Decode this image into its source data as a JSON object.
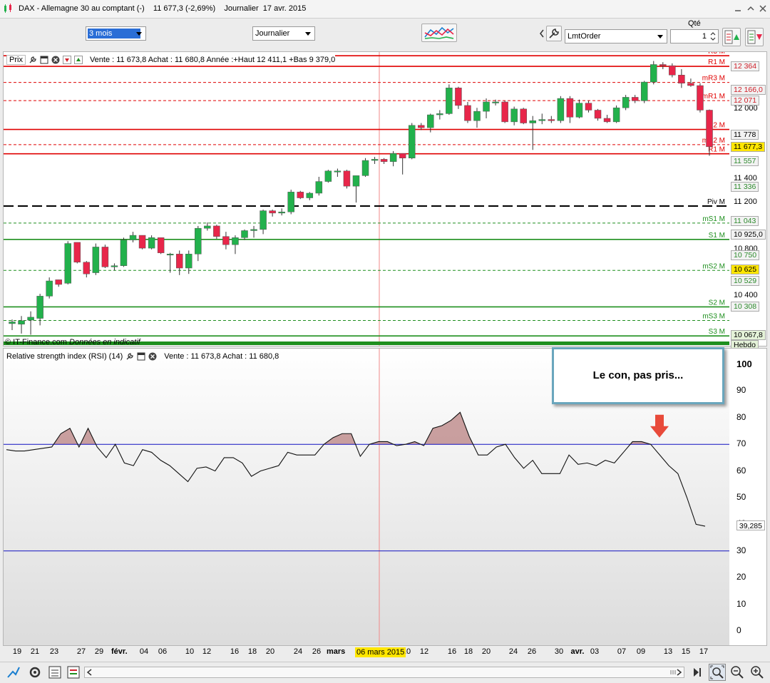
{
  "window": {
    "title": "DAX - Allemagne 30 au comptant (-)    11 677,3 (-2,69%)    Journalier  17 avr. 2015"
  },
  "toolbar": {
    "period": "3 mois",
    "interval": "Journalier",
    "order_type": "LmtOrder",
    "qty_label": "Qté",
    "qty_value": "1"
  },
  "price_panel": {
    "name": "Prix",
    "info": "Vente : 11 673,8 Achat : 11 680,8 Année :+Haut 12 411,1 +Bas 9 379,0",
    "credit_source": "© IT-Finance.com",
    "credit_note": "Données en indicatif",
    "axis_ticks": [
      "12 000",
      "11 400",
      "11 200",
      "10 800",
      "10 400"
    ],
    "price_labels": [
      {
        "text": "12 364",
        "color": "#d0202a",
        "bg": "#f2f2f2"
      },
      {
        "text": "12 166,0",
        "color": "#d0202a",
        "bg": "#f2f2f2"
      },
      {
        "text": "12 071",
        "color": "#d0202a",
        "bg": "#f2f2f2"
      },
      {
        "text": "11 778",
        "color": "#000000",
        "bg": "#f2f2f2"
      },
      {
        "text": "11 677,3",
        "color": "#000000",
        "bg": "#ffe600"
      },
      {
        "text": "11 557",
        "color": "#2e8b2e",
        "bg": "#f2f2f2"
      },
      {
        "text": "11 336",
        "color": "#2e8b2e",
        "bg": "#f2f2f2"
      },
      {
        "text": "11 043",
        "color": "#2e8b2e",
        "bg": "#f2f2f2"
      },
      {
        "text": "10 925,0",
        "color": "#000000",
        "bg": "#f2f2f2"
      },
      {
        "text": "10 750",
        "color": "#2e8b2e",
        "bg": "#f2f2f2"
      },
      {
        "text": "10 625",
        "color": "#000000",
        "bg": "#ffe600"
      },
      {
        "text": "10 529",
        "color": "#2e8b2e",
        "bg": "#f2f2f2"
      },
      {
        "text": "10 308",
        "color": "#2e8b2e",
        "bg": "#f2f2f2"
      },
      {
        "text": "10 067,8",
        "color": "#000000",
        "bg": "#e4f2d8"
      },
      {
        "text": "Hebdo",
        "color": "#000000",
        "bg": "#e4f2d8"
      }
    ]
  },
  "rsi_panel": {
    "name": "Relative strength index (RSI) (14)",
    "info": "Vente : 11 673,8 Achat : 11 680,8",
    "current_label": "39,285"
  },
  "crosshair_date": "06 mars 2015",
  "callout": {
    "text": "Le con, pas pris..."
  },
  "colors": {
    "bull": "#22b14c",
    "bear": "#e8264a",
    "resistance": "#e00000",
    "support": "#1e8f1e",
    "rsi_line": "#1010c0"
  },
  "chart_data": [
    {
      "type": "candlestick",
      "title": "DAX - Allemagne 30 au comptant (-)",
      "ylim": [
        10000,
        12450
      ],
      "x_tick_labels": [
        "19",
        "21",
        "23",
        "27",
        "29",
        "févr.",
        "04",
        "06",
        "10",
        "12",
        "16",
        "18",
        "20",
        "24",
        "26",
        "mars",
        "10",
        "12",
        "16",
        "18",
        "20",
        "24",
        "26",
        "30",
        "avr.",
        "03",
        "07",
        "09",
        "13",
        "15",
        "17"
      ],
      "candles": [
        {
          "open": 10165,
          "high": 10200,
          "low": 10110,
          "close": 10180
        },
        {
          "open": 10160,
          "high": 10230,
          "low": 10080,
          "close": 10190
        },
        {
          "open": 10195,
          "high": 10270,
          "low": 10070,
          "close": 10220
        },
        {
          "open": 10210,
          "high": 10420,
          "low": 10150,
          "close": 10400
        },
        {
          "open": 10400,
          "high": 10560,
          "low": 10380,
          "close": 10530
        },
        {
          "open": 10540,
          "high": 10540,
          "low": 10480,
          "close": 10500
        },
        {
          "open": 10510,
          "high": 10870,
          "low": 10500,
          "close": 10850
        },
        {
          "open": 10860,
          "high": 10860,
          "low": 10680,
          "close": 10690
        },
        {
          "open": 10690,
          "high": 10700,
          "low": 10560,
          "close": 10590
        },
        {
          "open": 10600,
          "high": 10850,
          "low": 10580,
          "close": 10820
        },
        {
          "open": 10820,
          "high": 10840,
          "low": 10640,
          "close": 10650
        },
        {
          "open": 10650,
          "high": 10680,
          "low": 10620,
          "close": 10660
        },
        {
          "open": 10660,
          "high": 10900,
          "low": 10650,
          "close": 10880
        },
        {
          "open": 10880,
          "high": 10950,
          "low": 10860,
          "close": 10920
        },
        {
          "open": 10920,
          "high": 10920,
          "low": 10800,
          "close": 10810
        },
        {
          "open": 10810,
          "high": 10920,
          "low": 10800,
          "close": 10900
        },
        {
          "open": 10900,
          "high": 10900,
          "low": 10760,
          "close": 10770
        },
        {
          "open": 10760,
          "high": 10770,
          "low": 10600,
          "close": 10760
        },
        {
          "open": 10760,
          "high": 10790,
          "low": 10580,
          "close": 10640
        },
        {
          "open": 10640,
          "high": 10790,
          "low": 10590,
          "close": 10760
        },
        {
          "open": 10760,
          "high": 11000,
          "low": 10700,
          "close": 10980
        },
        {
          "open": 10980,
          "high": 11030,
          "low": 10960,
          "close": 11000
        },
        {
          "open": 11000,
          "high": 11010,
          "low": 10890,
          "close": 10910
        },
        {
          "open": 10910,
          "high": 10950,
          "low": 10800,
          "close": 10840
        },
        {
          "open": 10840,
          "high": 10920,
          "low": 10760,
          "close": 10900
        },
        {
          "open": 10900,
          "high": 10970,
          "low": 10880,
          "close": 10960
        },
        {
          "open": 10960,
          "high": 11000,
          "low": 10900,
          "close": 10970
        },
        {
          "open": 10970,
          "high": 11140,
          "low": 10930,
          "close": 11130
        },
        {
          "open": 11130,
          "high": 11140,
          "low": 11080,
          "close": 11110
        },
        {
          "open": 11110,
          "high": 11150,
          "low": 11090,
          "close": 11120
        },
        {
          "open": 11120,
          "high": 11310,
          "low": 11100,
          "close": 11290
        },
        {
          "open": 11290,
          "high": 11300,
          "low": 11230,
          "close": 11240
        },
        {
          "open": 11240,
          "high": 11290,
          "low": 11220,
          "close": 11280
        },
        {
          "open": 11280,
          "high": 11420,
          "low": 11260,
          "close": 11380
        },
        {
          "open": 11380,
          "high": 11480,
          "low": 11370,
          "close": 11470
        },
        {
          "open": 11470,
          "high": 11490,
          "low": 11420,
          "close": 11470
        },
        {
          "open": 11470,
          "high": 11480,
          "low": 11320,
          "close": 11340
        },
        {
          "open": 11340,
          "high": 11420,
          "low": 11200,
          "close": 11430
        },
        {
          "open": 11430,
          "high": 11580,
          "low": 11420,
          "close": 11560
        },
        {
          "open": 11560,
          "high": 11590,
          "low": 11530,
          "close": 11570
        },
        {
          "open": 11570,
          "high": 11580,
          "low": 11530,
          "close": 11550
        },
        {
          "open": 11550,
          "high": 11640,
          "low": 11510,
          "close": 11620
        },
        {
          "open": 11620,
          "high": 11620,
          "low": 11440,
          "close": 11580
        },
        {
          "open": 11580,
          "high": 11880,
          "low": 11570,
          "close": 11860
        },
        {
          "open": 11860,
          "high": 11880,
          "low": 11820,
          "close": 11840
        },
        {
          "open": 11840,
          "high": 11960,
          "low": 11800,
          "close": 11950
        },
        {
          "open": 11950,
          "high": 11990,
          "low": 11910,
          "close": 11960
        },
        {
          "open": 11960,
          "high": 12210,
          "low": 11950,
          "close": 12180
        },
        {
          "open": 12180,
          "high": 12190,
          "low": 12000,
          "close": 12030
        },
        {
          "open": 12030,
          "high": 12060,
          "low": 11880,
          "close": 11900
        },
        {
          "open": 11900,
          "high": 12010,
          "low": 11840,
          "close": 11980
        },
        {
          "open": 11980,
          "high": 12090,
          "low": 11920,
          "close": 12060
        },
        {
          "open": 12060,
          "high": 12080,
          "low": 12030,
          "close": 12060
        },
        {
          "open": 12060,
          "high": 12070,
          "low": 11880,
          "close": 11890
        },
        {
          "open": 11890,
          "high": 12020,
          "low": 11860,
          "close": 12000
        },
        {
          "open": 12000,
          "high": 12010,
          "low": 11870,
          "close": 11880
        },
        {
          "open": 11880,
          "high": 11940,
          "low": 11650,
          "close": 11900
        },
        {
          "open": 11900,
          "high": 11960,
          "low": 11870,
          "close": 11910
        },
        {
          "open": 11910,
          "high": 11940,
          "low": 11880,
          "close": 11900
        },
        {
          "open": 11900,
          "high": 12110,
          "low": 11880,
          "close": 12090
        },
        {
          "open": 12090,
          "high": 12110,
          "low": 11880,
          "close": 11930
        },
        {
          "open": 11930,
          "high": 12080,
          "low": 11920,
          "close": 12050
        },
        {
          "open": 12050,
          "high": 12070,
          "low": 11970,
          "close": 11990
        },
        {
          "open": 11990,
          "high": 12000,
          "low": 11900,
          "close": 11920
        },
        {
          "open": 11920,
          "high": 11950,
          "low": 11880,
          "close": 11890
        },
        {
          "open": 11890,
          "high": 12030,
          "low": 11880,
          "close": 12010
        },
        {
          "open": 12010,
          "high": 12120,
          "low": 11990,
          "close": 12100
        },
        {
          "open": 12100,
          "high": 12120,
          "low": 12050,
          "close": 12070
        },
        {
          "open": 12070,
          "high": 12240,
          "low": 12050,
          "close": 12230
        },
        {
          "open": 12230,
          "high": 12410,
          "low": 12210,
          "close": 12380
        },
        {
          "open": 12380,
          "high": 12400,
          "low": 12340,
          "close": 12370
        },
        {
          "open": 12370,
          "high": 12390,
          "low": 12270,
          "close": 12290
        },
        {
          "open": 12290,
          "high": 12340,
          "low": 12180,
          "close": 12220
        },
        {
          "open": 12220,
          "high": 12260,
          "low": 12190,
          "close": 12200
        },
        {
          "open": 12200,
          "high": 12220,
          "low": 11970,
          "close": 11990
        },
        {
          "open": 11990,
          "high": 11995,
          "low": 11600,
          "close": 11677
        }
      ],
      "pivot_levels": [
        {
          "label": "R3 M",
          "value": 12455
        },
        {
          "label": "R1 M",
          "value": 12364
        },
        {
          "label": "mR3 M",
          "value": 12227
        },
        {
          "label": "mR1 M",
          "value": 12071
        },
        {
          "label": "R2 M",
          "value": 11825
        },
        {
          "label": "mR2 M",
          "value": 11695
        },
        {
          "label": "R1 M",
          "value": 11617
        },
        {
          "label": "Piv M",
          "value": 11170
        },
        {
          "label": "mS1 M",
          "value": 11025
        },
        {
          "label": "S1 M",
          "value": 10885
        },
        {
          "label": "mS2 M",
          "value": 10620
        },
        {
          "label": "S2 M",
          "value": 10308
        },
        {
          "label": "mS3 M",
          "value": 10192
        },
        {
          "label": "S3 M",
          "value": 10060
        }
      ]
    },
    {
      "type": "line",
      "title": "Relative strength index (RSI) (14)",
      "ylim": [
        0,
        100
      ],
      "y_ticks": [
        0,
        10,
        20,
        30,
        40,
        50,
        60,
        70,
        80,
        90,
        100
      ],
      "overbought": 70,
      "oversold": 30,
      "values": [
        68,
        67.5,
        67.5,
        68,
        68.5,
        69,
        74,
        76,
        69,
        76,
        69,
        65,
        70,
        63,
        62,
        68,
        67,
        64,
        62,
        59,
        56,
        61,
        61.5,
        60,
        65,
        65,
        63,
        58,
        60,
        61,
        62,
        67,
        66,
        66,
        66,
        70,
        72.5,
        74,
        74,
        65.5,
        70,
        71,
        71,
        69.5,
        70,
        71,
        69.5,
        76,
        77,
        79,
        82,
        73,
        66,
        66,
        69,
        70,
        65,
        61,
        64,
        59,
        59,
        59,
        66,
        62.5,
        63,
        62,
        64,
        63,
        67,
        71,
        71,
        70,
        66,
        62,
        59,
        50,
        40,
        39.285
      ]
    }
  ]
}
